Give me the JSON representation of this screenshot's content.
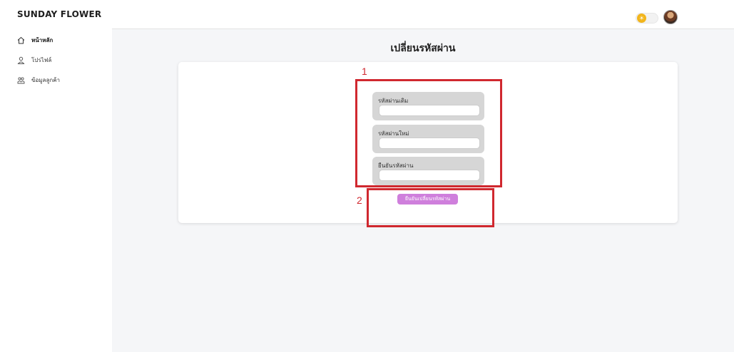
{
  "app": {
    "brand": "SUNDAY FLOWER"
  },
  "header": {
    "theme_toggle": {
      "state": "light",
      "icon": "sun-icon"
    },
    "avatar": "user-avatar"
  },
  "sidebar": {
    "items": [
      {
        "label": "หน้าหลัก",
        "icon": "home-icon",
        "active": true
      },
      {
        "label": "โปรไฟล์",
        "icon": "user-icon",
        "active": false
      },
      {
        "label": "ข้อมูลลูกค้า",
        "icon": "customers-icon",
        "active": false
      }
    ]
  },
  "page": {
    "title": "เปลี่ยนรหัสผ่าน",
    "fields": [
      {
        "label": "รหัสผ่านเดิม",
        "value": ""
      },
      {
        "label": "รหัสผ่านใหม่",
        "value": ""
      },
      {
        "label": "ยืนยันรหัสผ่าน",
        "value": ""
      }
    ],
    "submit_label": "ยืนยันเปลี่ยนรหัสผ่าน"
  },
  "annotations": [
    {
      "number": "1",
      "color": "#d0282f"
    },
    {
      "number": "2",
      "color": "#d0282f"
    }
  ],
  "colors": {
    "accent": "#8b3dff",
    "button": "#cf7fdc",
    "annotation": "#d0282f",
    "background": "#f5f6f8"
  }
}
